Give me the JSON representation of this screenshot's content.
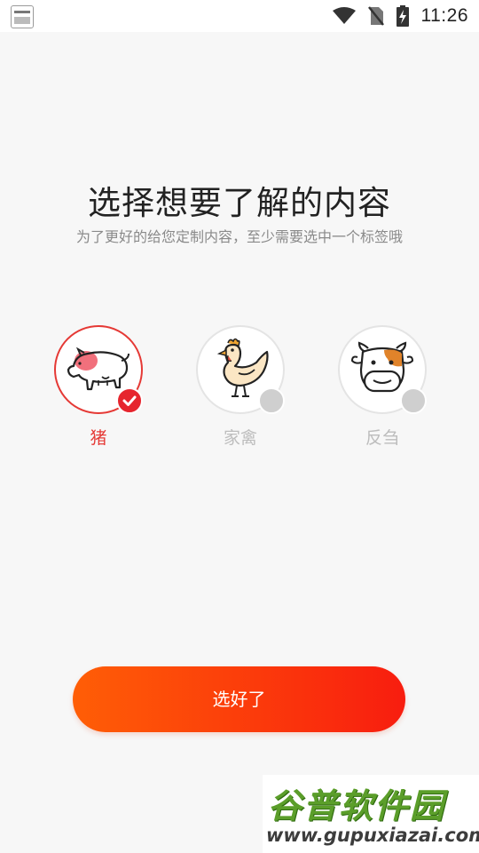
{
  "status_bar": {
    "time": "11:26",
    "icons": [
      "app-notification-icon",
      "wifi-icon",
      "no-sim-icon",
      "battery-charging-icon"
    ]
  },
  "header": {
    "title": "选择想要了解的内容",
    "subtitle": "为了更好的给您定制内容，至少需要选中一个标签哦"
  },
  "options": [
    {
      "label": "猪",
      "icon": "pig-icon",
      "selected": true
    },
    {
      "label": "家禽",
      "icon": "chicken-icon",
      "selected": false
    },
    {
      "label": "反刍",
      "icon": "cow-icon",
      "selected": false
    }
  ],
  "confirm_button": {
    "label": "选好了"
  },
  "watermark": {
    "title": "谷普软件园",
    "url": "www.gupuxiazai.com"
  },
  "colors": {
    "accent": "#e53935",
    "button_gradient_start": "#ff5e06",
    "button_gradient_end": "#f81d0f",
    "unselected": "#bdbdbd"
  }
}
